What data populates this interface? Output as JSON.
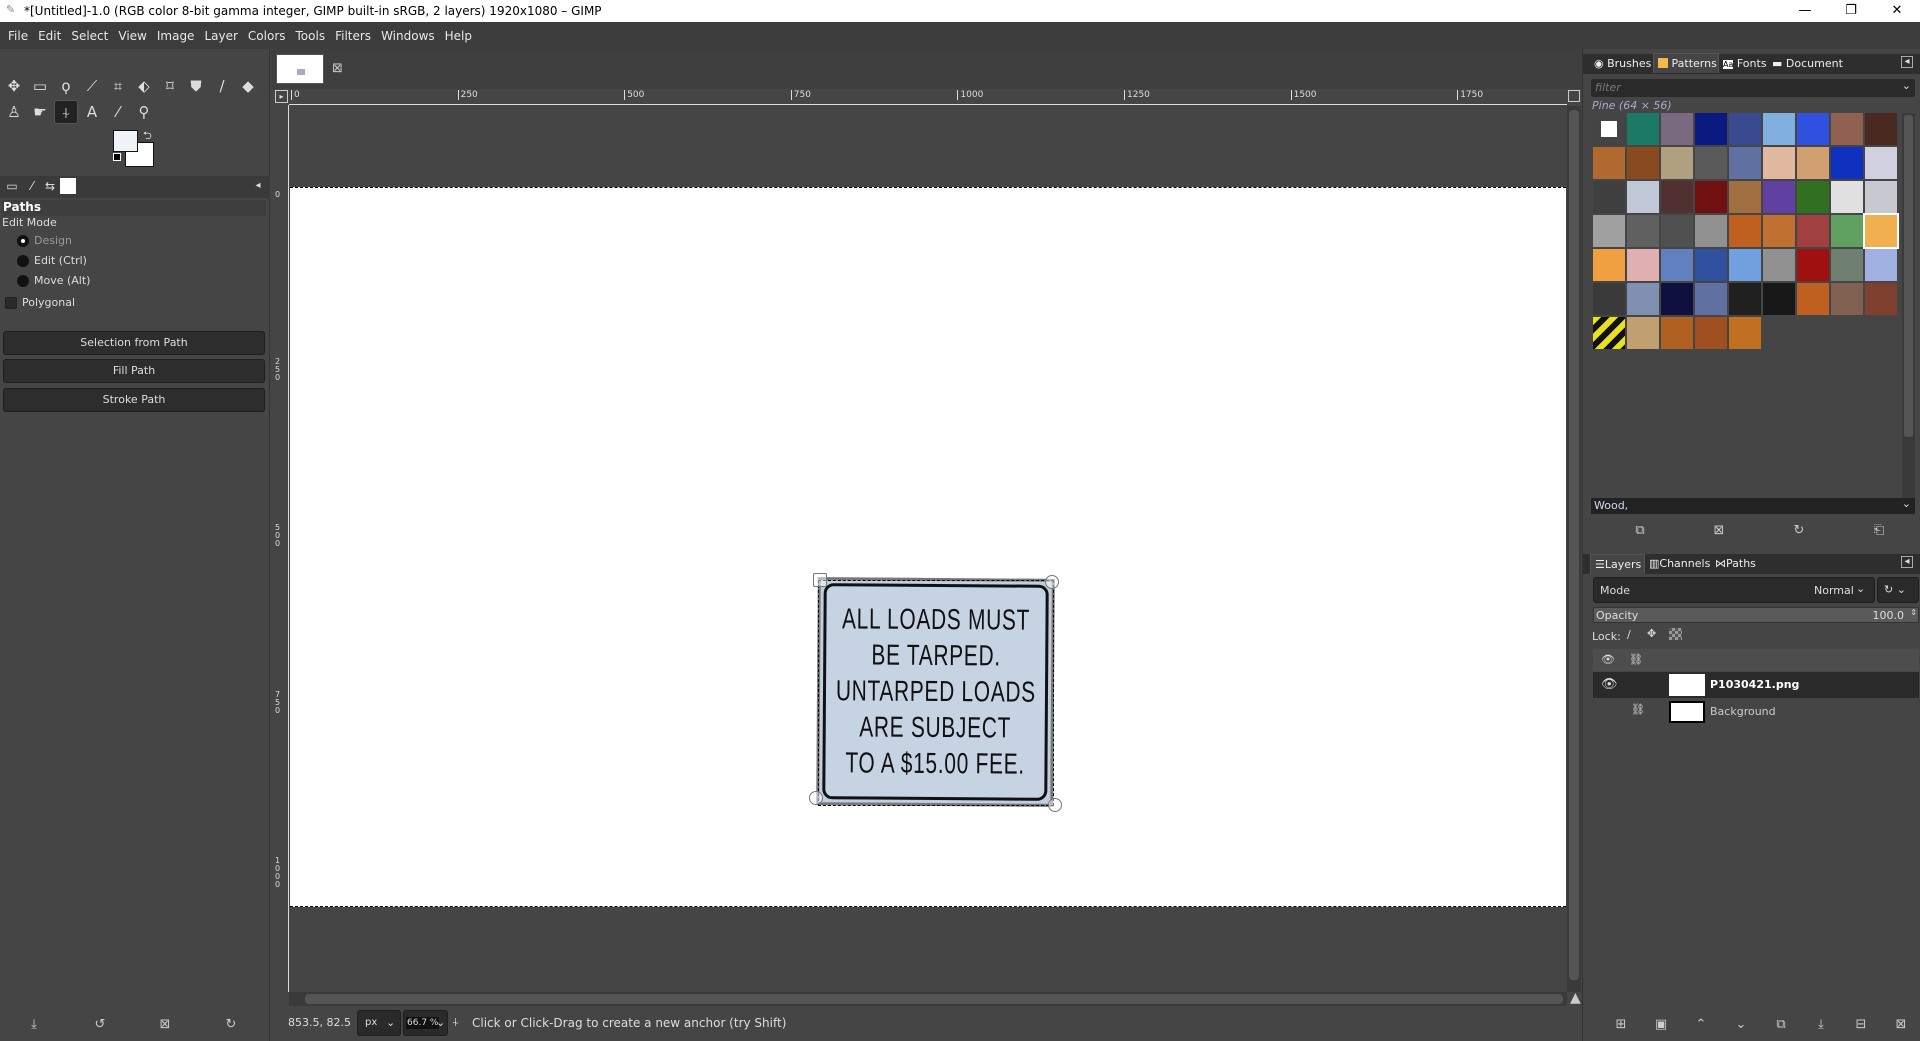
{
  "window": {
    "title": "*[Untitled]-1.0 (RGB color 8-bit gamma integer, GIMP built-in sRGB, 2 layers) 1920x1080 – GIMP",
    "minimize": "—",
    "maximize": "❐",
    "close": "✕"
  },
  "menu": [
    "File",
    "Edit",
    "Select",
    "View",
    "Image",
    "Layer",
    "Colors",
    "Tools",
    "Filters",
    "Windows",
    "Help"
  ],
  "toolbox": {
    "tools": [
      {
        "name": "move-tool-icon",
        "glyph": "✥"
      },
      {
        "name": "rect-select-icon",
        "glyph": "▭"
      },
      {
        "name": "free-select-icon",
        "glyph": "ϙ"
      },
      {
        "name": "fuzzy-select-icon",
        "glyph": "⟋"
      },
      {
        "name": "crop-icon",
        "glyph": "⌗"
      },
      {
        "name": "unified-transform-icon",
        "glyph": "⬖"
      },
      {
        "name": "cage-transform-icon",
        "glyph": "⌑"
      },
      {
        "name": "bucket-fill-icon",
        "glyph": "⛊"
      },
      {
        "name": "paintbrush-icon",
        "glyph": "∕"
      },
      {
        "name": "eraser-icon",
        "glyph": "◆"
      },
      {
        "name": "clone-icon",
        "glyph": "♙"
      },
      {
        "name": "smudge-icon",
        "glyph": "☛"
      },
      {
        "name": "paths-tool-icon",
        "glyph": "⍭",
        "active": true
      },
      {
        "name": "text-tool-icon",
        "glyph": "A"
      },
      {
        "name": "color-picker-icon",
        "glyph": "⁄"
      },
      {
        "name": "zoom-tool-icon",
        "glyph": "⚲"
      }
    ],
    "fg_color": "#eef3f7",
    "bg_color": "#ffffff"
  },
  "tool_options": {
    "title": "Paths",
    "edit_mode_label": "Edit Mode",
    "modes": [
      {
        "label": "Design",
        "selected": true
      },
      {
        "label": "Edit (Ctrl)",
        "selected": false
      },
      {
        "label": "Move (Alt)",
        "selected": false
      }
    ],
    "polygonal_label": "Polygonal",
    "polygonal_checked": false,
    "buttons": [
      "Selection from Path",
      "Fill Path",
      "Stroke Path"
    ]
  },
  "ruler": {
    "h_labels": [
      "0",
      "250",
      "500",
      "750",
      "1000",
      "1250",
      "1500",
      "1750"
    ],
    "v_labels": [
      "0",
      "250",
      "500",
      "750",
      "1000"
    ]
  },
  "sign": {
    "lines": [
      "ALL LOADS MUST",
      "BE TARPED.",
      "UNTARPED LOADS",
      "ARE SUBJECT",
      "TO A $15.00 FEE."
    ]
  },
  "status": {
    "coords": "853.5, 82.5",
    "unit": "px",
    "zoom": "66.7 %",
    "message": "Click or Click-Drag to create a new anchor (try Shift)"
  },
  "patterns_panel": {
    "tabs": [
      "Brushes",
      "Patterns",
      "Fonts",
      "Document History"
    ],
    "filter_placeholder": "filter",
    "selected_name": "Pine (64 × 56)",
    "tag_value": "Wood,",
    "swatches": [
      "#d8d8d8",
      "#1a7a66",
      "#7a6a80",
      "#0a1a80",
      "#3a4a90",
      "#80b0e0",
      "#3050e0",
      "#906050",
      "#4a2a20",
      "#b06a30",
      "#8a4a20",
      "#b0a080",
      "#5a5a5a",
      "#6070a0",
      "#e0b8a0",
      "#d0a070",
      "#1030c0",
      "#d0d0e0",
      "#404040",
      "#c0c8d8",
      "#503030",
      "#701010",
      "#a07040",
      "#6040a0",
      "#307020",
      "#e0e0e0",
      "#c8c8d0",
      "#a0a0a0",
      "#606060",
      "#505050",
      "#909090",
      "#c06020",
      "#c07030",
      "#a04040",
      "#60a060",
      "#f0b050",
      "#f0a040",
      "#e0b0b0",
      "#6080c0",
      "#3050a0",
      "#70a0e0",
      "#909090",
      "#a01010",
      "#708070",
      "#a0b0e0",
      "#3a3a3a",
      "#8090b0",
      "#101040",
      "#6070a0",
      "#202020",
      "#181818",
      "#c06020",
      "#806050",
      "#804030",
      "#e8e020",
      "#c0a070",
      "#b06020",
      "#a05020",
      "#c07020"
    ],
    "selected_index": 35
  },
  "layers_panel": {
    "tabs": [
      "Layers",
      "Channels",
      "Paths"
    ],
    "mode_label": "Mode",
    "mode_value": "Normal",
    "opacity_label": "Opacity",
    "opacity_value": "100.0",
    "lock_label": "Lock:",
    "layers": [
      {
        "name": "P1030421.png",
        "visible": true,
        "active": true
      },
      {
        "name": "Background",
        "visible": false,
        "linked": true
      }
    ]
  }
}
